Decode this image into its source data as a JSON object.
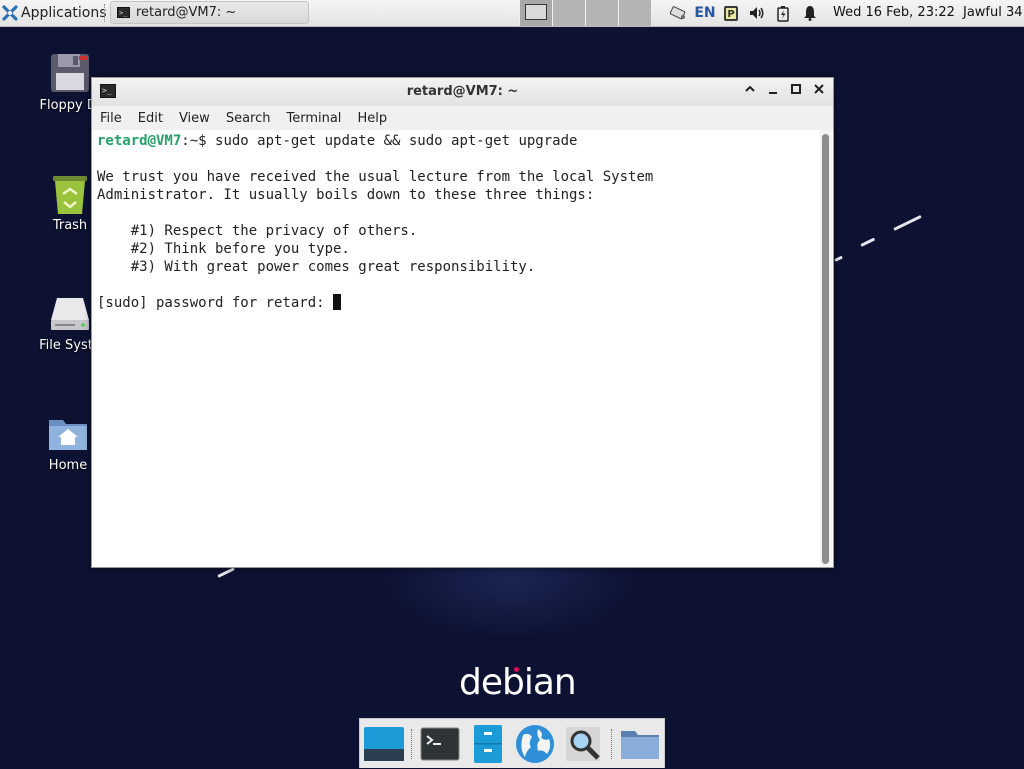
{
  "panel": {
    "applications_label": "Applications",
    "task_label": "retard@VM7: ~",
    "keyboard_layout": "EN",
    "clock": "Wed 16 Feb, 23:22",
    "user": "Jawful 34",
    "icons": [
      "applications-menu-icon",
      "terminal-icon",
      "network-icon",
      "keyboard-layout-indicator",
      "clipboard-icon",
      "volume-icon",
      "battery-icon",
      "notification-bell-icon"
    ]
  },
  "desktop": {
    "icons": [
      {
        "label": "Floppy Di"
      },
      {
        "label": "Trash"
      },
      {
        "label": "File Syste"
      },
      {
        "label": "Home"
      }
    ],
    "brand_text": "debian"
  },
  "window": {
    "title": "retard@VM7: ~",
    "menu": [
      "File",
      "Edit",
      "View",
      "Search",
      "Terminal",
      "Help"
    ],
    "terminal": {
      "prompt_user": "retard@VM7",
      "prompt_rest": ":~$ sudo apt-get update && sudo apt-get upgrade",
      "lecture_line1": "We trust you have received the usual lecture from the local System",
      "lecture_line2": "Administrator. It usually boils down to these three things:",
      "rule1": "    #1) Respect the privacy of others.",
      "rule2": "    #2) Think before you type.",
      "rule3": "    #3) With great power comes great responsibility.",
      "password_prompt": "[sudo] password for retard: "
    }
  },
  "dock": {
    "items": [
      "show-desktop",
      "terminal",
      "file-manager",
      "web-browser",
      "app-finder",
      "home-folder"
    ]
  },
  "colors": {
    "desktop_bg": "#0d1233",
    "prompt_green": "#26a269",
    "debian_red": "#d70a53"
  }
}
